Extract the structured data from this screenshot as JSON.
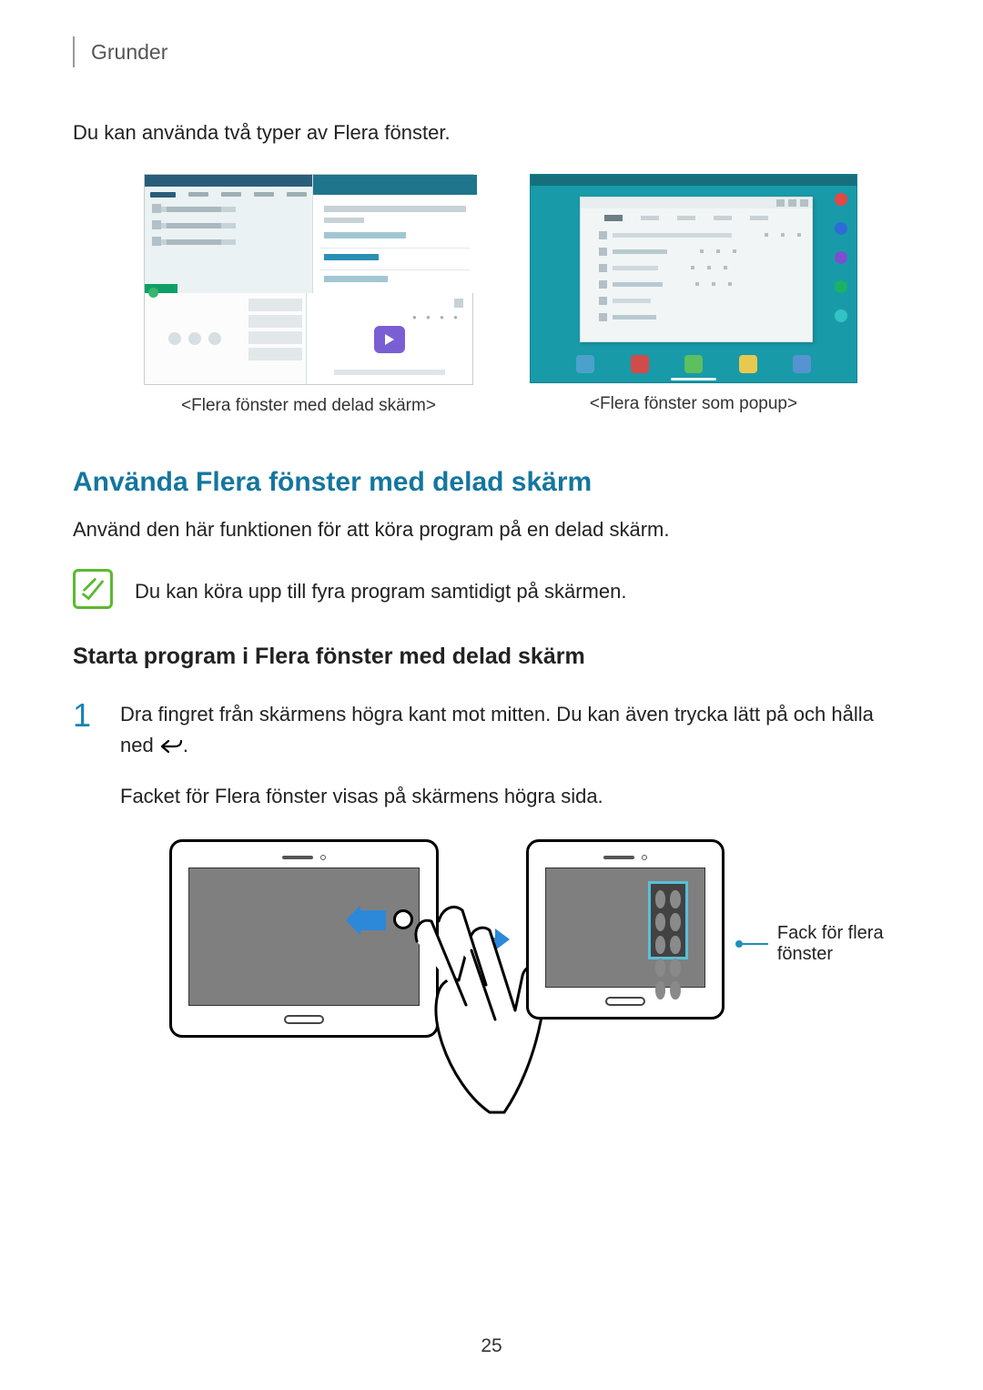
{
  "breadcrumb": "Grunder",
  "intro": "Du kan använda två typer av Flera fönster.",
  "fig1_caption": "<Flera fönster med delad skärm>",
  "fig2_caption": "<Flera fönster som popup>",
  "heading": "Använda Flera fönster med delad skärm",
  "heading_desc": "Använd den här funktionen för att köra program på en delad skärm.",
  "note": "Du kan köra upp till fyra program samtidigt på skärmen.",
  "subheading": "Starta program i Flera fönster med delad skärm",
  "step1_num": "1",
  "step1_a": "Dra fingret från skärmens högra kant mot mitten. Du kan även trycka lätt på och hålla ned ",
  "step1_b": ".",
  "step1_followup": "Facket för Flera fönster visas på skärmens högra sida.",
  "callout_label": "Fack för flera fönster",
  "page_number": "25"
}
